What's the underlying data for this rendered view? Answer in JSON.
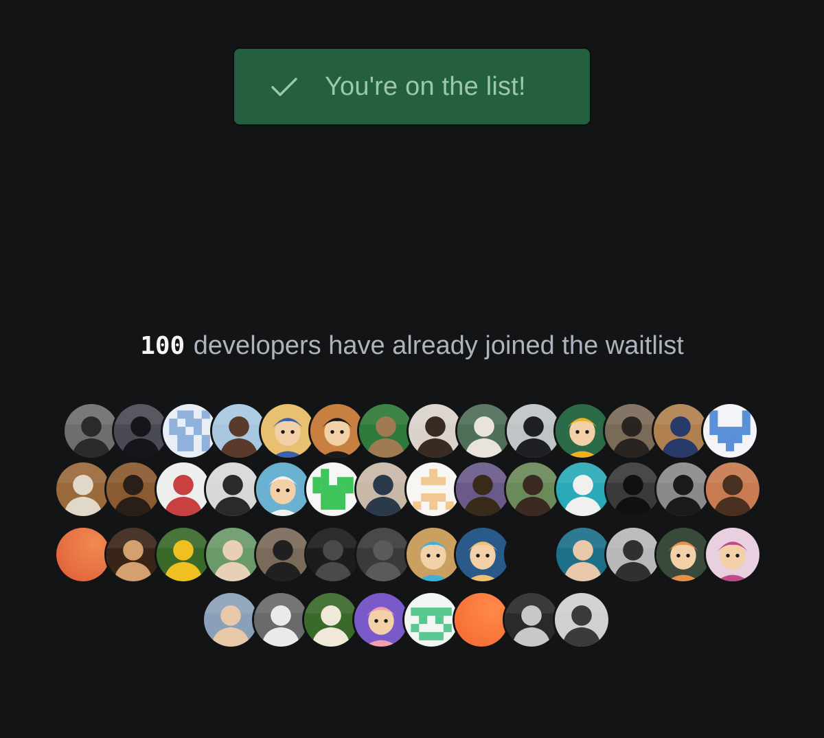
{
  "confirmation": {
    "icon": "check-icon",
    "label": "You're on the list!",
    "background_color": "#24603f",
    "text_color": "#9cc7ab"
  },
  "waitlist": {
    "count": "100",
    "text": " developers have already joined the waitlist"
  },
  "avatar_rows": [
    [
      {
        "kind": "photo",
        "bg": "#6e6e6e",
        "fg": "#2a2a2a"
      },
      {
        "kind": "photo",
        "bg": "#4a4a55",
        "fg": "#15151a"
      },
      {
        "kind": "identicon",
        "bg": "#e8eef6",
        "fg": "#8fb1dc",
        "pattern": "0110110110110100110101101"
      },
      {
        "kind": "photo",
        "bg": "#a8c8e0",
        "fg": "#5a3a2a"
      },
      {
        "kind": "cartoon",
        "bg": "#e8c070",
        "fg": "#3a5fb0"
      },
      {
        "kind": "cartoon",
        "bg": "#c88040",
        "fg": "#1a1a1a"
      },
      {
        "kind": "photo",
        "bg": "#2e7a3a",
        "fg": "#a07a50"
      },
      {
        "kind": "photo",
        "bg": "#d9d3cb",
        "fg": "#3a2b22"
      },
      {
        "kind": "photo",
        "bg": "#4f6e58",
        "fg": "#e8e4dc"
      },
      {
        "kind": "photo",
        "bg": "#bfc4c6",
        "fg": "#1e2024"
      },
      {
        "kind": "cartoon",
        "bg": "#2b6b48",
        "fg": "#f0b020"
      },
      {
        "kind": "photo",
        "bg": "#7a6a58",
        "fg": "#2a2420"
      },
      {
        "kind": "photo",
        "bg": "#b08050",
        "fg": "#283a6a"
      },
      {
        "kind": "identicon",
        "bg": "#f2f4f8",
        "fg": "#5b8fd6",
        "pattern": "1000110001111110111000100"
      }
    ],
    [
      {
        "kind": "photo",
        "bg": "#9a6a3a",
        "fg": "#e0d8c8"
      },
      {
        "kind": "photo",
        "bg": "#8a5a30",
        "fg": "#2a1f18"
      },
      {
        "kind": "photo",
        "bg": "#eeeeee",
        "fg": "#c84040"
      },
      {
        "kind": "photo",
        "bg": "#d8d8d8",
        "fg": "#2a2a2a"
      },
      {
        "kind": "cartoon",
        "bg": "#6ab0d0",
        "fg": "#f0f0f0"
      },
      {
        "kind": "identicon",
        "bg": "#f5f7f5",
        "fg": "#3fc45c",
        "pattern": "0100011011111110111001110"
      },
      {
        "kind": "photo",
        "bg": "#c8b8a8",
        "fg": "#2a3a4a"
      },
      {
        "kind": "identicon",
        "bg": "#f8f6f2",
        "fg": "#f0c890",
        "pattern": "0010001110000000111010101"
      },
      {
        "kind": "photo",
        "bg": "#6a5a8a",
        "fg": "#3a2a1a"
      },
      {
        "kind": "photo",
        "bg": "#6a8a5a",
        "fg": "#3a2a20"
      },
      {
        "kind": "photo",
        "bg": "#2aaab8",
        "fg": "#f0f0f0"
      },
      {
        "kind": "photo",
        "bg": "#3a3a3a",
        "fg": "#101010"
      },
      {
        "kind": "photo",
        "bg": "#8a8a8a",
        "fg": "#1a1a1a"
      },
      {
        "kind": "photo",
        "bg": "#c87a50",
        "fg": "#4a3020"
      }
    ],
    [
      {
        "kind": "solid",
        "bg": "#e0603a",
        "fg": "#f08a50"
      },
      {
        "kind": "photo",
        "bg": "#3a2418",
        "fg": "#d4a070"
      },
      {
        "kind": "photo",
        "bg": "#3a6a2a",
        "fg": "#f0c020"
      },
      {
        "kind": "photo",
        "bg": "#6a9a6a",
        "fg": "#e8d0b8"
      },
      {
        "kind": "photo",
        "bg": "#7a6a5a",
        "fg": "#202020"
      },
      {
        "kind": "photo",
        "bg": "#1c1c1c",
        "fg": "#4a4a4a"
      },
      {
        "kind": "photo",
        "bg": "#3a3a3a",
        "fg": "#5a5a5a"
      },
      {
        "kind": "cartoon",
        "bg": "#c9a060",
        "fg": "#40b0d8"
      },
      {
        "kind": "cartoon",
        "bg": "#2a5a8a",
        "fg": "#f0c070"
      },
      {
        "kind": "solid",
        "bg": "#141414",
        "fg": "#141414"
      },
      {
        "kind": "photo",
        "bg": "#1e6f8a",
        "fg": "#e8c8a8"
      },
      {
        "kind": "photo",
        "bg": "#b8b8b8",
        "fg": "#303030"
      },
      {
        "kind": "cartoon",
        "bg": "#3a4a3a",
        "fg": "#e89048"
      },
      {
        "kind": "cartoon",
        "bg": "#e8d0e0",
        "fg": "#c04a8a"
      }
    ],
    [
      {
        "kind": "photo",
        "bg": "#8aa0b8",
        "fg": "#e8c8a8"
      },
      {
        "kind": "photo",
        "bg": "#6a6a6a",
        "fg": "#eaeaea"
      },
      {
        "kind": "photo",
        "bg": "#3a6a2a",
        "fg": "#f0e8d8"
      },
      {
        "kind": "cartoon",
        "bg": "#7a5ac8",
        "fg": "#f0a0b0"
      },
      {
        "kind": "identicon",
        "bg": "#f2f6f2",
        "fg": "#58c890",
        "pattern": "0000011111010101000101110"
      },
      {
        "kind": "solid",
        "bg": "#f56a32",
        "fg": "#ff8a4a"
      },
      {
        "kind": "photo",
        "bg": "#2a2a2a",
        "fg": "#c8c8c8"
      },
      {
        "kind": "photo",
        "bg": "#d0d0d0",
        "fg": "#3a3a3a"
      }
    ]
  ]
}
